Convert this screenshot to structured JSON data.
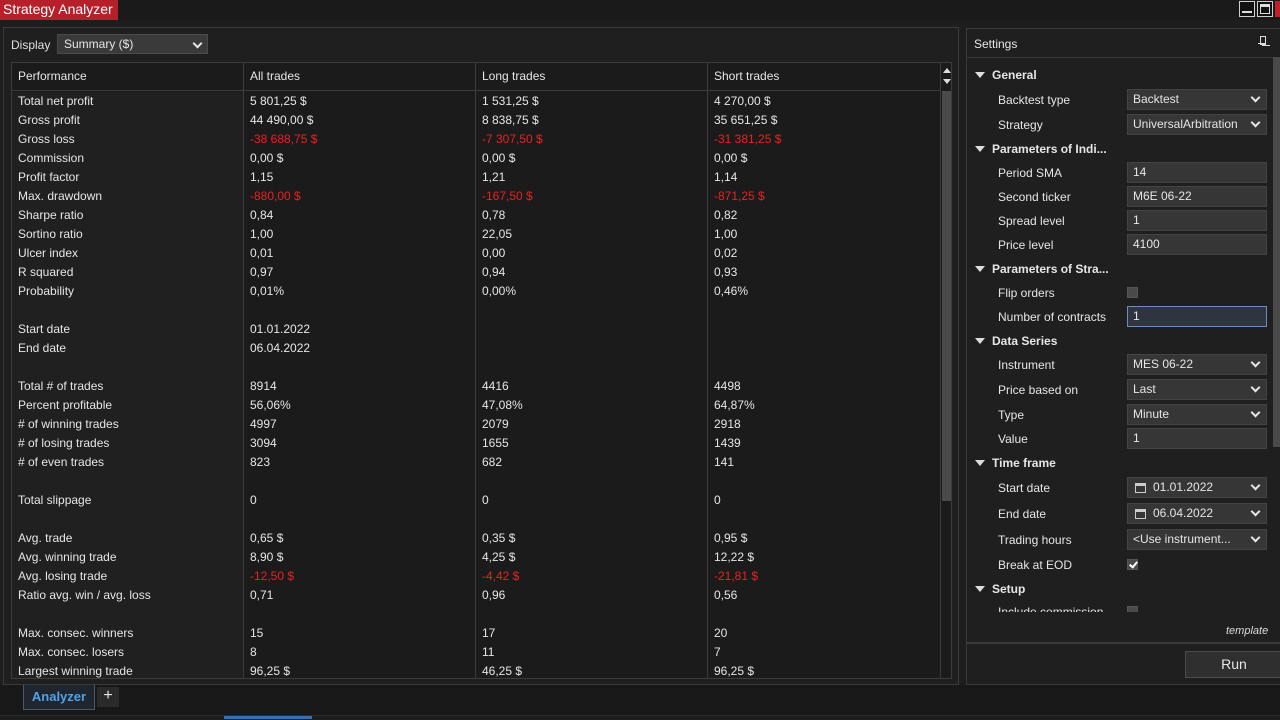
{
  "window": {
    "title": "Strategy Analyzer"
  },
  "display": {
    "label": "Display",
    "selected": "Summary ($)"
  },
  "table": {
    "headers": [
      "Performance",
      "All trades",
      "Long trades",
      "Short trades"
    ],
    "rows": [
      [
        "Total net profit",
        "5 801,25 $",
        "1 531,25 $",
        "4 270,00 $"
      ],
      [
        "Gross profit",
        "44 490,00 $",
        "8 838,75 $",
        "35 651,25 $"
      ],
      [
        "Gross loss",
        "-38 688,75 $",
        "-7 307,50 $",
        "-31 381,25 $"
      ],
      [
        "Commission",
        "0,00 $",
        "0,00 $",
        "0,00 $"
      ],
      [
        "Profit factor",
        "1,15",
        "1,21",
        "1,14"
      ],
      [
        "Max. drawdown",
        "-880,00 $",
        "-167,50 $",
        "-871,25 $"
      ],
      [
        "Sharpe ratio",
        "0,84",
        "0,78",
        "0,82"
      ],
      [
        "Sortino ratio",
        "1,00",
        "22,05",
        "1,00"
      ],
      [
        "Ulcer index",
        "0,01",
        "0,00",
        "0,02"
      ],
      [
        "R squared",
        "0,97",
        "0,94",
        "0,93"
      ],
      [
        "Probability",
        "0,01%",
        "0,00%",
        "0,46%"
      ],
      [
        "",
        "",
        "",
        ""
      ],
      [
        "Start date",
        "01.01.2022",
        "",
        ""
      ],
      [
        "End date",
        "06.04.2022",
        "",
        ""
      ],
      [
        "",
        "",
        "",
        ""
      ],
      [
        "Total # of trades",
        "8914",
        "4416",
        "4498"
      ],
      [
        "Percent profitable",
        "56,06%",
        "47,08%",
        "64,87%"
      ],
      [
        "# of winning trades",
        "4997",
        "2079",
        "2918"
      ],
      [
        "# of losing trades",
        "3094",
        "1655",
        "1439"
      ],
      [
        "# of even trades",
        "823",
        "682",
        "141"
      ],
      [
        "",
        "",
        "",
        ""
      ],
      [
        "Total slippage",
        "0",
        "0",
        "0"
      ],
      [
        "",
        "",
        "",
        ""
      ],
      [
        "Avg. trade",
        "0,65 $",
        "0,35 $",
        "0,95 $"
      ],
      [
        "Avg. winning trade",
        "8,90 $",
        "4,25 $",
        "12,22 $"
      ],
      [
        "Avg. losing trade",
        "-12,50 $",
        "-4,42 $",
        "-21,81 $"
      ],
      [
        "Ratio avg. win / avg. loss",
        "0,71",
        "0,96",
        "0,56"
      ],
      [
        "",
        "",
        "",
        ""
      ],
      [
        "Max. consec. winners",
        "15",
        "17",
        "20"
      ],
      [
        "Max. consec. losers",
        "8",
        "11",
        "7"
      ],
      [
        "Largest winning trade",
        "96,25 $",
        "46,25 $",
        "96,25 $"
      ]
    ],
    "negative_color": "#e8231f"
  },
  "settings": {
    "title": "Settings",
    "sections": {
      "general": "General",
      "indicator_params": "Parameters of Indi...",
      "strategy_params": "Parameters of Stra...",
      "data_series": "Data Series",
      "time_frame": "Time frame",
      "setup": "Setup"
    },
    "props": {
      "backtest_type": {
        "label": "Backtest type",
        "value": "Backtest"
      },
      "strategy": {
        "label": "Strategy",
        "value": "UniversalArbitration"
      },
      "period_sma": {
        "label": "Period SMA",
        "value": "14"
      },
      "second_ticker": {
        "label": "Second ticker",
        "value": "M6E 06-22"
      },
      "spread_level": {
        "label": "Spread level",
        "value": "1"
      },
      "price_level": {
        "label": "Price level",
        "value": "4100"
      },
      "flip_orders": {
        "label": "Flip orders",
        "checked": false
      },
      "number_of_contracts": {
        "label": "Number of contracts",
        "value": "1"
      },
      "instrument": {
        "label": "Instrument",
        "value": "MES 06-22"
      },
      "price_based_on": {
        "label": "Price based on",
        "value": "Last"
      },
      "type": {
        "label": "Type",
        "value": "Minute"
      },
      "value": {
        "label": "Value",
        "value": "1"
      },
      "start_date": {
        "label": "Start date",
        "value": "01.01.2022"
      },
      "end_date": {
        "label": "End date",
        "value": "06.04.2022"
      },
      "trading_hours": {
        "label": "Trading hours",
        "value": "<Use instrument..."
      },
      "break_at_eod": {
        "label": "Break at EOD",
        "checked": true
      },
      "include_commission": {
        "label": "Include commission",
        "checked": false
      }
    },
    "template_label": "template",
    "run_label": "Run"
  },
  "tabs": [
    {
      "label": "Analyzer",
      "active": true
    }
  ],
  "add_tab_label": "+"
}
